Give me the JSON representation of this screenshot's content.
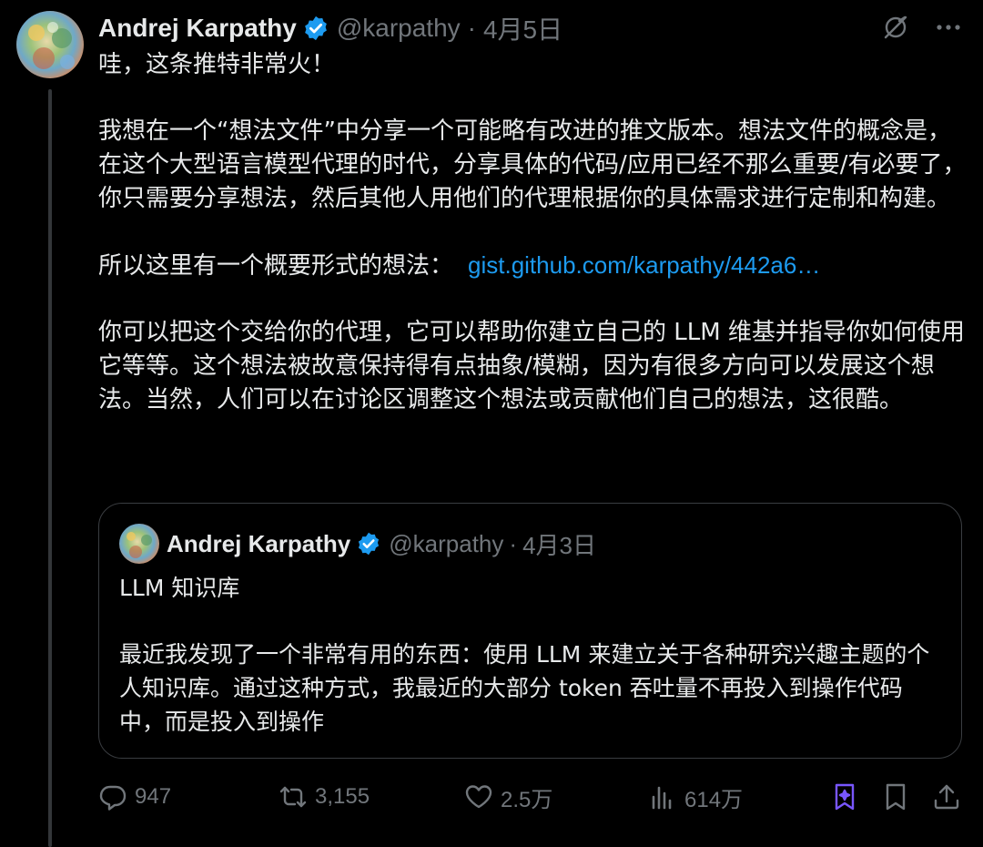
{
  "tweet": {
    "author_name": "Andrej Karpathy",
    "handle": "@karpathy",
    "separator": "·",
    "date": "4月5日",
    "paragraphs": [
      "哇，这条推特非常火！",
      "我想在一个“想法文件”中分享一个可能略有改进的推文版本。想法文件的概念是，在这个大型语言模型代理的时代，分享具体的代码/应用已经不那么重要/有必要了，你只需要分享想法，然后其他人用他们的代理根据你的具体需求进行定制和构建。",
      "所以这里有一个概要形式的想法：",
      "你可以把这个交给你的代理，它可以帮助你建立自己的 LLM 维基并指导你如何使用它等等。这个想法被故意保持得有点抽象/模糊，因为有很多方向可以发展这个想法。当然，人们可以在讨论区调整这个想法或贡献他们自己的想法，这很酷。"
    ],
    "link_text": "gist.github.com/karpathy/442a6…"
  },
  "quoted_tweet": {
    "author_name": "Andrej Karpathy",
    "handle": "@karpathy",
    "separator": "·",
    "date": "4月3日",
    "title": "LLM 知识库",
    "text": "最近我发现了一个非常有用的东西：使用 LLM 来建立关于各种研究兴趣主题的个人知识库。通过这种方式，我最近的大部分 token 吞吐量不再投入到操作代码中，而是投入到操作"
  },
  "actions": {
    "replies": "947",
    "retweets": "3,155",
    "likes": "2.5万",
    "views": "614万"
  },
  "icons": {
    "top": [
      "grok-off-icon",
      "more-icon"
    ],
    "bottom": [
      "reply-icon",
      "retweet-icon",
      "like-icon",
      "views-icon",
      "grok-icon",
      "bookmark-icon",
      "share-icon"
    ]
  },
  "colors": {
    "background": "#000000",
    "text": "#e7e9ea",
    "muted": "#71767b",
    "link": "#1d9bf0",
    "verified": "#1d9bf0",
    "grok": "#7856ff"
  }
}
